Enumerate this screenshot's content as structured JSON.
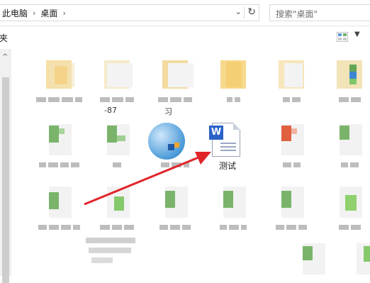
{
  "address_bar": {
    "crumbs": [
      "此电脑",
      "桌面"
    ],
    "separator": "›",
    "dropdown_glyph": "⌄",
    "refresh_glyph": "↻"
  },
  "search": {
    "placeholder": "搜索\"桌面\""
  },
  "toolbar": {
    "cut_label": "夹",
    "view_drop_glyph": "▼"
  },
  "nav_scroll": {
    "up_glyph": "^"
  },
  "truncated_labels": [
    "-87",
    "习"
  ],
  "highlighted_file": {
    "name": "测试",
    "icon": "word-document-icon",
    "badge": "W"
  },
  "colors": {
    "folder_yellow": "#f6dea5",
    "doc_green": "#7ab46a",
    "word_blue": "#2a62c9",
    "arrow_red": "#e0252a",
    "globe_blue": "#4a9ad8"
  }
}
